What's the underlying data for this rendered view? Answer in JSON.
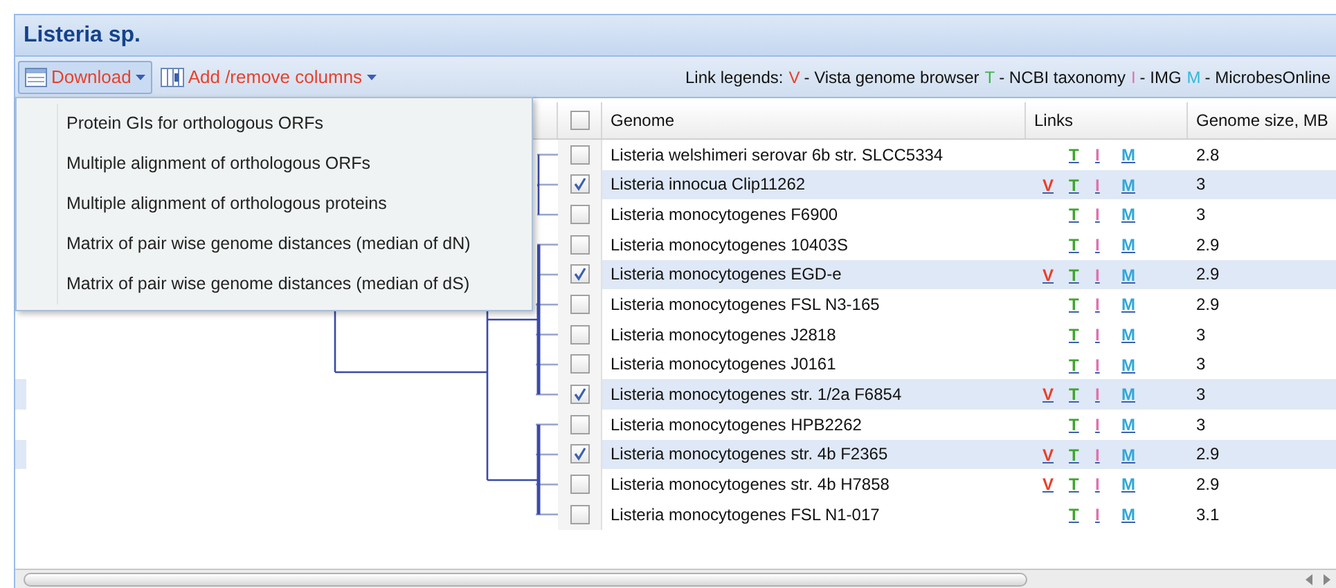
{
  "panel": {
    "title": "Listeria sp."
  },
  "toolbar": {
    "download": {
      "label": "Download",
      "expanded": true
    },
    "columns_button": {
      "label": "Add /remove columns"
    },
    "legend_label": "Link legends:",
    "legend": [
      {
        "key": "V",
        "text": "- Vista genome browser",
        "color": "#e8402a"
      },
      {
        "key": "T",
        "text": "- NCBI taxonomy",
        "color": "#3cb44a"
      },
      {
        "key": "I",
        "text": "- IMG",
        "color": "#e070b0"
      },
      {
        "key": "M",
        "text": "- MicrobesOnline",
        "color": "#30b8d8"
      }
    ]
  },
  "download_menu": [
    "Protein GIs for orthologous ORFs",
    "Multiple alignment of orthologous ORFs",
    "Multiple alignment of orthologous proteins",
    "Matrix of pair wise genome distances (median of dN)",
    "Matrix of pair wise genome distances (median of dS)"
  ],
  "table": {
    "header_checked": false,
    "columns": [
      "Genome",
      "Links",
      "Genome size, MB"
    ],
    "rows": [
      {
        "genome": "Listeria welshimeri serovar 6b str. SLCC5334",
        "selected": false,
        "links": [
          {
            "kind": "taxonomy",
            "label": "T"
          },
          {
            "kind": "img",
            "label": "I"
          },
          {
            "kind": "microbes",
            "label": "M"
          }
        ],
        "size": "2.8"
      },
      {
        "genome": "Listeria innocua Clip11262",
        "selected": true,
        "links": [
          {
            "kind": "vista",
            "label": "V"
          },
          {
            "kind": "taxonomy",
            "label": "T"
          },
          {
            "kind": "img",
            "label": "I"
          },
          {
            "kind": "microbes",
            "label": "M"
          }
        ],
        "size": "3"
      },
      {
        "genome": "Listeria monocytogenes F6900",
        "selected": false,
        "links": [
          {
            "kind": "taxonomy",
            "label": "T"
          },
          {
            "kind": "img",
            "label": "I"
          },
          {
            "kind": "microbes",
            "label": "M"
          }
        ],
        "size": "3"
      },
      {
        "genome": "Listeria monocytogenes 10403S",
        "selected": false,
        "links": [
          {
            "kind": "taxonomy",
            "label": "T"
          },
          {
            "kind": "img",
            "label": "I"
          },
          {
            "kind": "microbes",
            "label": "M"
          }
        ],
        "size": "2.9"
      },
      {
        "genome": "Listeria monocytogenes EGD-e",
        "selected": true,
        "links": [
          {
            "kind": "vista",
            "label": "V"
          },
          {
            "kind": "taxonomy",
            "label": "T"
          },
          {
            "kind": "img",
            "label": "I"
          },
          {
            "kind": "microbes",
            "label": "M"
          }
        ],
        "size": "2.9"
      },
      {
        "genome": "Listeria monocytogenes FSL N3-165",
        "selected": false,
        "links": [
          {
            "kind": "taxonomy",
            "label": "T"
          },
          {
            "kind": "img",
            "label": "I"
          },
          {
            "kind": "microbes",
            "label": "M"
          }
        ],
        "size": "2.9"
      },
      {
        "genome": "Listeria monocytogenes J2818",
        "selected": false,
        "links": [
          {
            "kind": "taxonomy",
            "label": "T"
          },
          {
            "kind": "img",
            "label": "I"
          },
          {
            "kind": "microbes",
            "label": "M"
          }
        ],
        "size": "3"
      },
      {
        "genome": "Listeria monocytogenes J0161",
        "selected": false,
        "links": [
          {
            "kind": "taxonomy",
            "label": "T"
          },
          {
            "kind": "img",
            "label": "I"
          },
          {
            "kind": "microbes",
            "label": "M"
          }
        ],
        "size": "3"
      },
      {
        "genome": "Listeria monocytogenes str. 1/2a F6854",
        "selected": true,
        "links": [
          {
            "kind": "vista",
            "label": "V"
          },
          {
            "kind": "taxonomy",
            "label": "T"
          },
          {
            "kind": "img",
            "label": "I"
          },
          {
            "kind": "microbes",
            "label": "M"
          }
        ],
        "size": "3"
      },
      {
        "genome": "Listeria monocytogenes HPB2262",
        "selected": false,
        "links": [
          {
            "kind": "taxonomy",
            "label": "T"
          },
          {
            "kind": "img",
            "label": "I"
          },
          {
            "kind": "microbes",
            "label": "M"
          }
        ],
        "size": "3"
      },
      {
        "genome": "Listeria monocytogenes str. 4b F2365",
        "selected": true,
        "links": [
          {
            "kind": "vista",
            "label": "V"
          },
          {
            "kind": "taxonomy",
            "label": "T"
          },
          {
            "kind": "img",
            "label": "I"
          },
          {
            "kind": "microbes",
            "label": "M"
          }
        ],
        "size": "2.9"
      },
      {
        "genome": "Listeria monocytogenes str. 4b H7858",
        "selected": false,
        "links": [
          {
            "kind": "vista",
            "label": "V"
          },
          {
            "kind": "taxonomy",
            "label": "T"
          },
          {
            "kind": "img",
            "label": "I"
          },
          {
            "kind": "microbes",
            "label": "M"
          }
        ],
        "size": "2.9"
      },
      {
        "genome": "Listeria monocytogenes FSL N1-017",
        "selected": false,
        "links": [
          {
            "kind": "taxonomy",
            "label": "T"
          },
          {
            "kind": "img",
            "label": "I"
          },
          {
            "kind": "microbes",
            "label": "M"
          }
        ],
        "size": "3.1"
      }
    ]
  }
}
